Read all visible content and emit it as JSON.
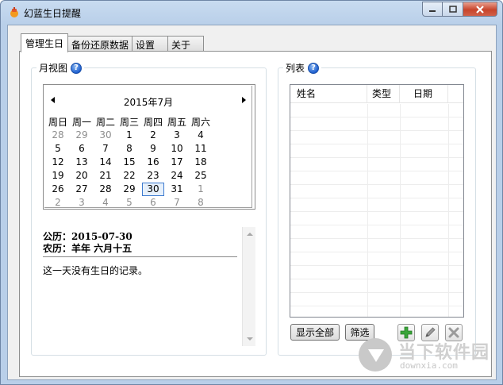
{
  "window": {
    "title": "幻蓝生日提醒"
  },
  "tabs": [
    {
      "label": "管理生日",
      "active": true
    },
    {
      "label": "备份还原数据",
      "active": false
    },
    {
      "label": "设置",
      "active": false
    },
    {
      "label": "关于",
      "active": false
    }
  ],
  "month_view": {
    "title": "月视图",
    "month_label": "2015年7月",
    "weekdays": [
      "周日",
      "周一",
      "周二",
      "周三",
      "周四",
      "周五",
      "周六"
    ],
    "days": [
      [
        "28",
        "29",
        "30",
        "1",
        "2",
        "3",
        "4"
      ],
      [
        "5",
        "6",
        "7",
        "8",
        "9",
        "10",
        "11"
      ],
      [
        "12",
        "13",
        "14",
        "15",
        "16",
        "17",
        "18"
      ],
      [
        "19",
        "20",
        "21",
        "22",
        "23",
        "24",
        "25"
      ],
      [
        "26",
        "27",
        "28",
        "29",
        "30",
        "31",
        "1"
      ],
      [
        "2",
        "3",
        "4",
        "5",
        "6",
        "7",
        "8"
      ]
    ],
    "selected_day": "30",
    "info": {
      "solar": "公历：2015-07-30",
      "lunar": "农历：羊年  六月十五",
      "note": "这一天没有生日的记录。"
    }
  },
  "list": {
    "title": "列表",
    "columns": [
      "姓名",
      "类型",
      "日期"
    ],
    "rows": [],
    "show_all_label": "显示全部",
    "filter_label": "筛选"
  },
  "watermark": {
    "text": "当下软件园",
    "sub": "downxia.com"
  },
  "colors": {
    "accent": "#3d7bd0",
    "add_green": "#3aa53a"
  }
}
